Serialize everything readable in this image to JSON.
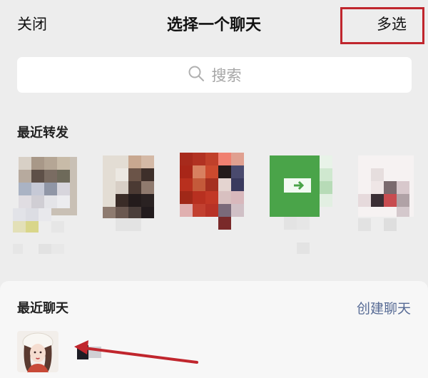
{
  "header": {
    "close_label": "关闭",
    "title": "选择一个聊天",
    "multi_select_label": "多选"
  },
  "search": {
    "placeholder": "搜索"
  },
  "recent_forwards": {
    "heading": "最近转发"
  },
  "recent_chats": {
    "heading": "最近聊天",
    "create_chat_label": "创建聊天"
  },
  "colors": {
    "background": "#ededed",
    "link": "#576b95",
    "highlight": "#c0262d",
    "annotation_arrow": "#c0262d"
  }
}
